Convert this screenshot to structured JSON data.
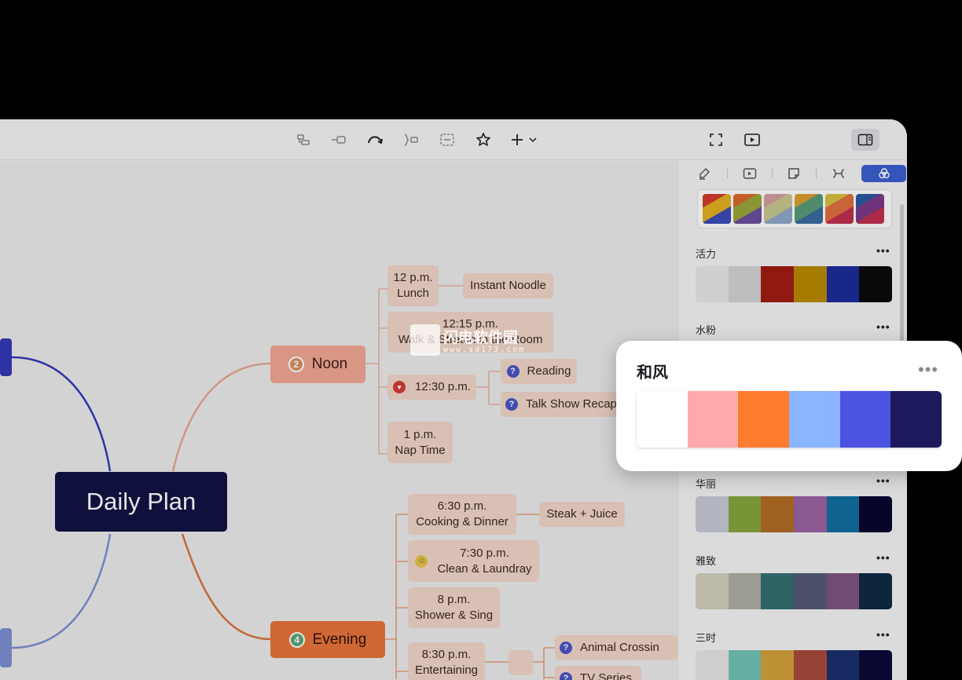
{
  "toolbar": {
    "buttons": [
      "subtopic-icon",
      "topic-icon",
      "relationship-icon",
      "summary-icon",
      "boundary-icon",
      "star-icon",
      "insert-icon"
    ],
    "right": [
      "fit-icon",
      "present-icon",
      "panel-toggle-icon"
    ]
  },
  "mindmap": {
    "root": "Daily Plan",
    "noon": {
      "number": "2",
      "label": "Noon"
    },
    "evening": {
      "number": "4",
      "label": "Evening"
    },
    "lunch_time": "12 p.m.",
    "lunch_label": "Lunch",
    "instant_noodle": "Instant Noodle",
    "stretch_time": "12:15 p.m.",
    "stretch_label": "Walk & Stretch in the Room",
    "twelve_thirty": "12:30 p.m.",
    "reading": "Reading",
    "talk_show": "Talk Show Recap",
    "nap_time": "1 p.m.",
    "nap_label": "Nap Time",
    "cooking_time": "6:30 p.m.",
    "cooking_label": "Cooking & Dinner",
    "steak": "Steak + Juice",
    "clean_time": "7:30 p.m.",
    "clean_label": "Clean & Laundray",
    "shower_time": "8 p.m.",
    "shower_label": "Shower & Sing",
    "ent_time": "8:30 p.m.",
    "ent_label": "Entertaining",
    "animal": "Animal Crossin",
    "tv": "TV Series"
  },
  "panel": {
    "tabs": [
      "style-icon",
      "pitch-icon",
      "note-icon",
      "map-icon",
      "theme-icon"
    ],
    "themes": [
      {
        "name": "活力",
        "colors": [
          "#e7e7e9",
          "#d4d4d6",
          "#a01c14",
          "#b88a00",
          "#1d2c9a",
          "#0c0c0c"
        ]
      },
      {
        "name": "水粉",
        "colors": []
      },
      {
        "name": "华丽",
        "colors": [
          "#c8cbd6",
          "#86a53d",
          "#b06d24",
          "#9b62a3",
          "#126fa0",
          "#0a0630"
        ]
      },
      {
        "name": "雅致",
        "colors": [
          "#d3d0bf",
          "#aeaea3",
          "#356f70",
          "#555b75",
          "#7d5580",
          "#0f2a44"
        ]
      },
      {
        "name": "三时",
        "colors": [
          "#e6e6e8",
          "#73c2b5",
          "#d4a23c",
          "#a84a3c",
          "#1b2f6e",
          "#0b0b3a"
        ]
      }
    ],
    "more": "•••"
  },
  "popup": {
    "title": "和风",
    "more": "•••",
    "colors": [
      "#ffffff",
      "#ffaaaa",
      "#ff7b2e",
      "#8ab4ff",
      "#4b52e0",
      "#1c1a5c"
    ]
  },
  "watermark": {
    "text": "闪电软件园",
    "url": "www.sd173.com"
  },
  "colors": {
    "accent": "#3a5fd0",
    "root": "#121245",
    "noon": "#f2a894",
    "evening": "#e8733a"
  }
}
